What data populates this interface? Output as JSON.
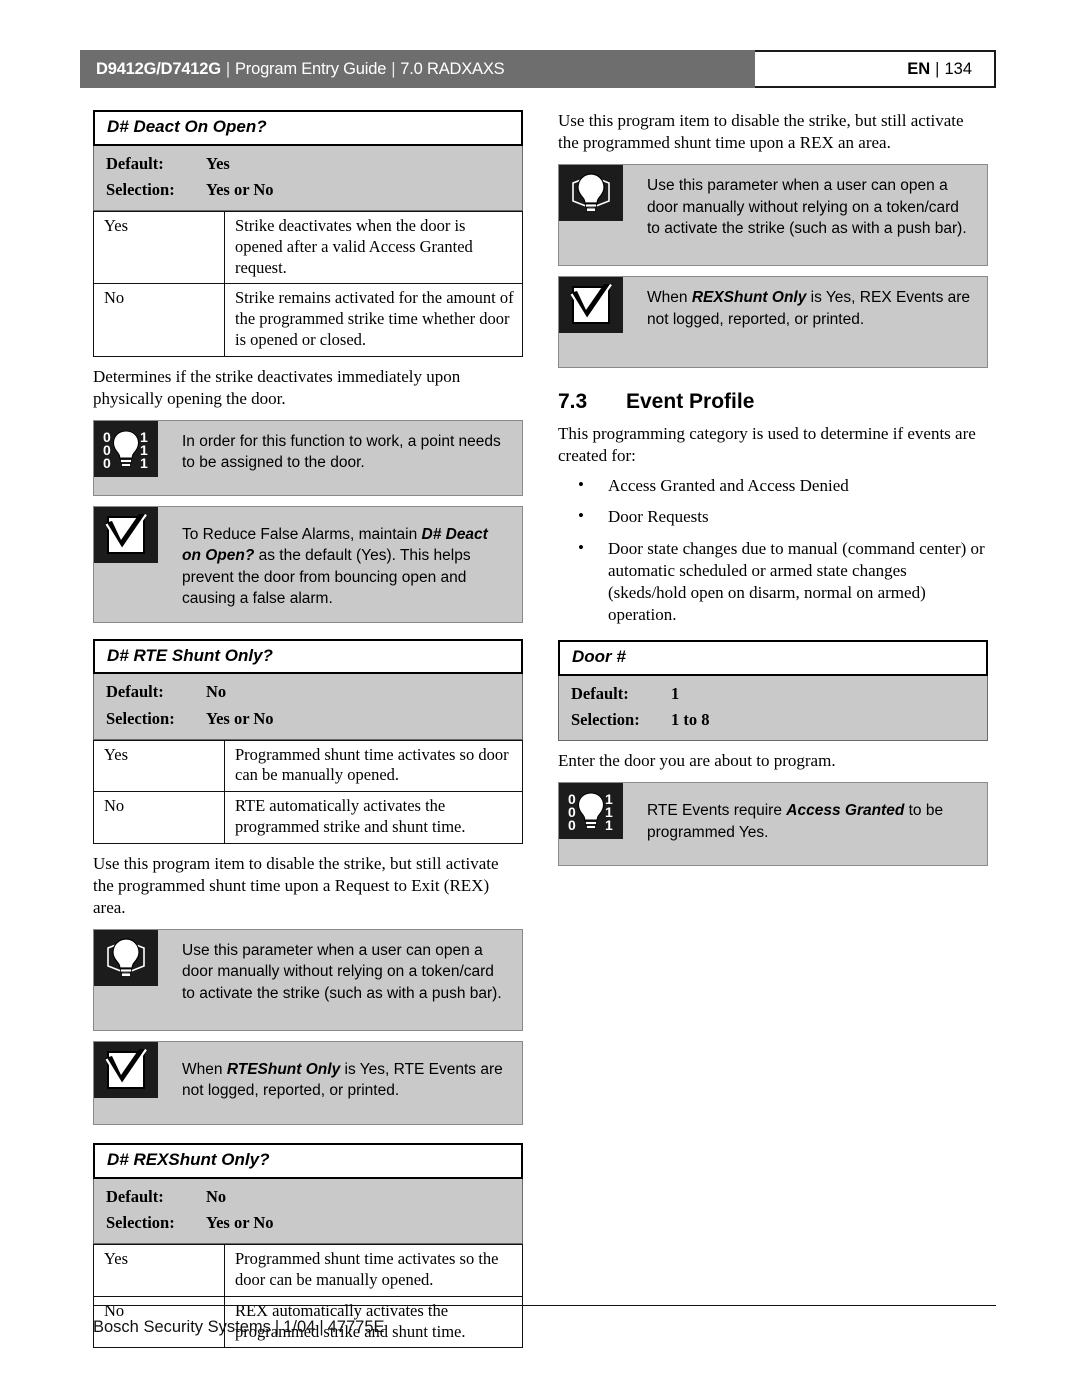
{
  "header": {
    "model": "D9412G/D7412G",
    "separator": "|",
    "guide": "Program Entry Guide",
    "section": "7.0  RADXAXS",
    "lang": "EN",
    "page_number": "134"
  },
  "left_column": {
    "param1": {
      "title": "D# Deact On Open?",
      "default_label": "Default:",
      "default_value": "Yes",
      "selection_label": "Selection:",
      "selection_value": "Yes or No",
      "rows": [
        {
          "key": "Yes",
          "value": "Strike deactivates when the door is opened after a valid Access Granted request."
        },
        {
          "key": "No",
          "value": "Strike remains activated for the amount of the programmed strike time whether door is opened or closed."
        }
      ],
      "description": "Determines if the strike deactivates immediately upon physically opening the door.",
      "note1": {
        "icon": "lightbulb-binary-icon",
        "text": "In order for this function to work, a point needs to be assigned to the door."
      },
      "note2": {
        "icon": "checkbox-check-icon",
        "text_part1": "To Reduce False Alarms, maintain ",
        "text_bold1": "D# Deact on Open?",
        "text_part2": " as the default (Yes). This helps prevent the door from bouncing open and causing a false alarm."
      }
    },
    "param2": {
      "title": "D# RTE Shunt Only?",
      "default_label": "Default:",
      "default_value": "No",
      "selection_label": "Selection:",
      "selection_value": "Yes or No",
      "rows": [
        {
          "key": "Yes",
          "value": "Programmed shunt time activates so door can be manually opened."
        },
        {
          "key": "No",
          "value": "RTE automatically activates the programmed strike and shunt time."
        }
      ],
      "description": "Use this program item to disable the strike, but still activate the programmed shunt time upon a Request to Exit (REX) area.",
      "note1": {
        "icon": "lightbulb-icon",
        "text": "Use this parameter when a user can open a door manually without relying on a token/card to activate the strike (such as with a push bar)."
      },
      "note2": {
        "icon": "checkbox-check-icon",
        "text_part1": "When ",
        "text_bold1": "RTEShunt Only",
        "text_part2": " is Yes, RTE Events are not logged, reported, or printed."
      }
    },
    "param3": {
      "title": "D# REXShunt Only?",
      "default_label": "Default:",
      "default_value": "No",
      "selection_label": "Selection:",
      "selection_value": "Yes or No",
      "rows": [
        {
          "key": "Yes",
          "value": "Programmed shunt time activates so the door can be manually opened."
        },
        {
          "key": "No",
          "value": "REX automatically activates the programmed strike and shunt time."
        }
      ]
    }
  },
  "right_column": {
    "intro_paragraph": "Use this program item to disable the strike, but still activate the programmed shunt time upon a REX an area.",
    "note1": {
      "icon": "lightbulb-icon",
      "text": "Use this parameter when a user can open a door manually without relying on a token/card to activate the strike (such as with a push bar)."
    },
    "note2": {
      "icon": "checkbox-check-icon",
      "text_part1": "When ",
      "text_bold1": "REXShunt Only",
      "text_part2": " is Yes, REX Events are not logged, reported, or printed."
    },
    "section": {
      "number": "7.3",
      "title": "Event Profile",
      "intro": "This programming category is used to determine if events are created for:",
      "bullets": [
        "Access Granted and Access Denied",
        "Door Requests",
        "Door state changes due to manual (command center) or automatic scheduled or armed state changes (skeds/hold open on disarm, normal on armed) operation."
      ]
    },
    "param1": {
      "title": "Door #",
      "default_label": "Default:",
      "default_value": "1",
      "selection_label": "Selection:",
      "selection_value": "1 to 8",
      "description": "Enter the door you are about to program.",
      "note1": {
        "icon": "lightbulb-binary-icon",
        "text_part1": "RTE Events require ",
        "text_bold1": "Access Granted",
        "text_part2": " to be programmed Yes."
      }
    }
  },
  "footer": {
    "company": "Bosch Security Systems",
    "sep": "|",
    "date": "1/04",
    "doc_number": "47775E"
  },
  "colors": {
    "header_gray": "#6e6e6e",
    "table_gray": "#c9c9c9",
    "icon_black": "#1c1c1c"
  }
}
